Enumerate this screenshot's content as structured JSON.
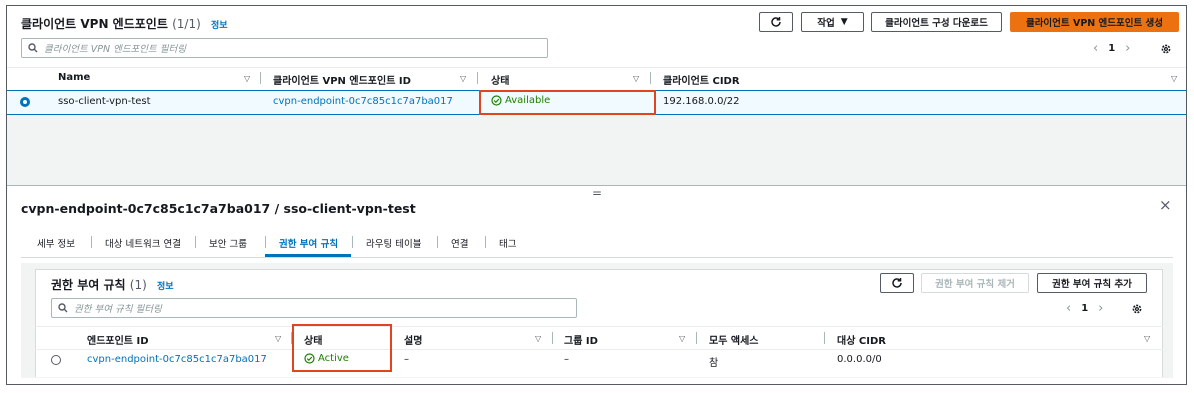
{
  "top": {
    "title": "클라이언트 VPN 엔드포인트",
    "count": "(1/1)",
    "info": "정보",
    "actions_label": "작업",
    "download_label": "클라이언트 구성 다운로드",
    "create_label": "클라이언트 VPN 엔드포인트 생성",
    "search_placeholder": "클라이언트 VPN 엔드포인트 필터링",
    "page_number": "1",
    "columns": [
      "Name",
      "클라이언트 VPN 엔드포인트 ID",
      "상태",
      "클라이언트 CIDR"
    ],
    "row": {
      "name": "sso-client-vpn-test",
      "endpoint_id": "cvpn-endpoint-0c7c85c1c7a7ba017",
      "status": "Available",
      "cidr": "192.168.0.0/22"
    }
  },
  "splitter": "=",
  "detail": {
    "title": "cvpn-endpoint-0c7c85c1c7a7ba017 / sso-client-vpn-test",
    "tabs": [
      "세부 정보",
      "대상 네트워크 연결",
      "보안 그룹",
      "권한 부여 규칙",
      "라우팅 테이블",
      "연결",
      "태그"
    ],
    "active_tab": "권한 부여 규칙"
  },
  "auth": {
    "title": "권한 부여 규칙",
    "count": "(1)",
    "info": "정보",
    "remove_label": "권한 부여 규칙 제거",
    "add_label": "권한 부여 규칙 추가",
    "search_placeholder": "권한 부여 규칙 필터링",
    "page_number": "1",
    "columns": [
      "엔드포인트 ID",
      "상태",
      "설명",
      "그룹 ID",
      "모두 액세스",
      "대상 CIDR"
    ],
    "row": {
      "endpoint_id": "cvpn-endpoint-0c7c85c1c7a7ba017",
      "status": "Active",
      "description": "–",
      "group_id": "–",
      "all_access": "참",
      "cidr": "0.0.0.0/0"
    }
  },
  "colors": {
    "link": "#0073bb",
    "success": "#1d8102",
    "primary": "#ec7211",
    "highlight": "#e0451f"
  }
}
